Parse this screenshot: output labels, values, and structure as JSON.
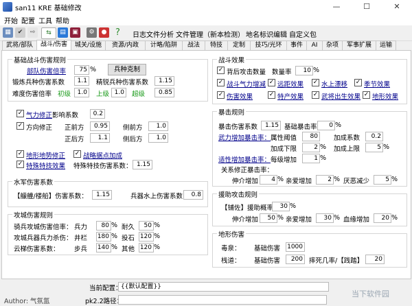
{
  "window": {
    "title": "san11 KRE 基础修改",
    "min": "—",
    "max": "☐",
    "close": "✕"
  },
  "menu": [
    "开始",
    "配置",
    "工具",
    "帮助"
  ],
  "toolbar": {
    "links": [
      "日志文件分析",
      "文件管理（新本检测）",
      "地名标识编辑",
      "自定义包"
    ]
  },
  "tabs": [
    "武将/部队",
    "战斗/伤害",
    "城关/设施",
    "资源/内政",
    "计略/陷阱",
    "战法",
    "特技",
    "定制",
    "技巧/光环",
    "事件",
    "AI",
    "杂项",
    "军事扩展",
    "运输"
  ],
  "basic": {
    "title": "基础战斗伤害规则",
    "troop_multiplier_label": "部队伤害倍率",
    "troop_multiplier": "75",
    "troop_multiplier_unit": "%",
    "counter_button": "兵种克制",
    "forge_label": "锻炼兵种伤害系数",
    "forge_value": "1.1",
    "elite_label": "精锐兵种伤害系数",
    "elite_value": "1.15",
    "difficulty_label": "难度伤害倍率",
    "beginner_label": "初级",
    "beginner_value": "1.0",
    "advanced_label": "上级",
    "advanced_value": "1.0",
    "super_label": "超级",
    "super_value": "0.85"
  },
  "qiqi": {
    "label": "气力修正",
    "effect_label": "影响系数",
    "effect_value": "0.2",
    "direction_label": "方向修正",
    "front_label": "正前方",
    "front_value": "0.95",
    "front_side_label": "侧前方",
    "front_side_value": "1.0",
    "back_label": "正后方",
    "back_value": "1.1",
    "back_side_label": "侧后方",
    "back_side_value": "1.0"
  },
  "terrain": {
    "terrain_fix": "地形地势修正",
    "strongpoint": "战略据点加成",
    "special_effect": "特殊特技效果",
    "special_coef_label": "特殊特技伤害系数：",
    "special_coef_value": "1.15"
  },
  "water": {
    "title": "水军伤害系数",
    "ship_label": "【艨艟/楼船】伤害系数：",
    "ship_value": "1.15",
    "bing_label": "兵器水上伤害系数：",
    "bing_value": "0.8"
  },
  "siege": {
    "title": "攻城伤害规则",
    "cav_label": "骑兵攻城伤害倍率：",
    "troops_label": "兵力",
    "troops_value": "80",
    "endure_label": "耐久",
    "endure_value": "50",
    "weapon_label": "攻城兵器兵力杀伤：",
    "jinglan_label": "井栏",
    "jinglan_value": "180",
    "toushi_label": "投石",
    "toushi_value": "120",
    "yunti_label": "云梯伤害系数：",
    "infantry_label": "步兵",
    "infantry_value": "140",
    "other_label": "其他",
    "other_value": "120",
    "unit": "%"
  },
  "battle": {
    "title": "战斗效果",
    "back_attack": "背后攻击数量",
    "count_label": "数量率",
    "count_value": "10",
    "count_unit": "%",
    "effects": [
      "战斗气力增减",
      "远距效果",
      "水上漂移",
      "季节效果",
      "伤害效果",
      "特产效果",
      "武将出生效果",
      "地形效果"
    ]
  },
  "crit": {
    "title": "暴击规则",
    "crit_coef_label": "暴击伤害系数",
    "crit_coef_value": "1.15",
    "base_rate_label": "基础暴击率",
    "base_rate_value": "0",
    "base_rate_unit": "%",
    "martial_label": "武力增加暴击率：",
    "attr_label": "属性阈值",
    "attr_value": "80",
    "add_coef_label": "加成系数",
    "add_coef_value": "0.2",
    "lower_label": "加成下限",
    "lower_value": "2",
    "upper_label": "加成上限",
    "upper_value": "5",
    "lucky_label": "适性增加暴击率：",
    "per_level_label": "每级增加",
    "per_level_value": "1",
    "relation_label": "关系修正暴击率：",
    "fellow_label": "伸介增加",
    "fellow_value": "4",
    "family_label": "亲爱增加",
    "family_value": "2",
    "enemy_label": "厌恶减少",
    "enemy_value": "5",
    "unit": "%"
  },
  "aid": {
    "title": "援助攻击规则",
    "rate_label": "【铺佐】援助概率",
    "rate_value": "30",
    "fellow_label": "伸介增加",
    "fellow_value": "50",
    "family_label": "亲爱增加",
    "family_value": "30",
    "blood_label": "血缘增加",
    "blood_value": "20",
    "unit": "%"
  },
  "terrain_dmg": {
    "title": "地形伤害",
    "poison_label": "毒泉：",
    "poison_base_label": "基础伤害",
    "poison_base_value": "1000",
    "path_label": "栈道：",
    "path_base_label": "基础伤害",
    "path_base_value": "200",
    "fall_label": "摔死几率/【践踏】",
    "fall_value": "20"
  },
  "footer": {
    "config_label": "当前配置：",
    "config_value": "{{默认配置}}",
    "path_label": "pk2.2路径：",
    "author": "Author: 气氛氲",
    "watermark": "当下软件园"
  }
}
